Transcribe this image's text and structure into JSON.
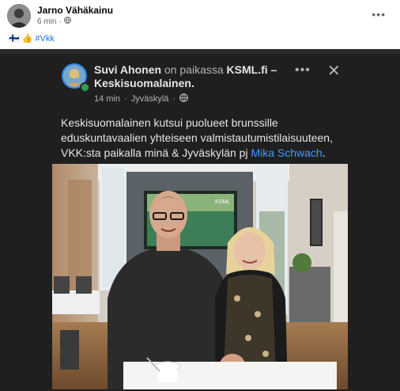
{
  "outer_post": {
    "author": "Jarno Vähäkainu",
    "time": "6 min",
    "more": "•••",
    "text_flag": "🇫🇮",
    "text_thumb": "👍",
    "hashtag": "#Vkk"
  },
  "shared_post": {
    "author": "Suvi Ahonen",
    "at_text": "on paikassa",
    "place": "KSML.fi – Keskisuomalainen.",
    "time": "14 min",
    "location": "Jyväskylä",
    "more": "•••",
    "close": "✕",
    "text": "Keskisuomalainen kutsui puolueet brunssille eduskuntavaalien yhteiseen valmistautumistilaisuuteen, VKK:sta paikalla minä & Jyväskylän pj ",
    "mention": "Mika Schwach",
    "text_end": ".",
    "photo_tv_label": "KSML"
  },
  "colors": {
    "dark_bg": "#1f1f1f",
    "link_blue": "#4599ff",
    "hashtag_blue": "#1b74e4",
    "online_green": "#31a24c"
  }
}
